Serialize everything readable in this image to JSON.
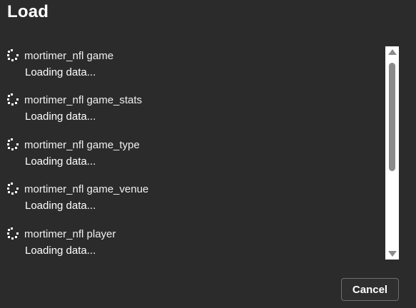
{
  "dialog": {
    "title": "Load",
    "cancel_label": "Cancel"
  },
  "items": [
    {
      "name": "mortimer_nfl game",
      "status": "Loading data...",
      "icon": "loading-spinner-icon"
    },
    {
      "name": "mortimer_nfl game_stats",
      "status": "Loading data...",
      "icon": "loading-spinner-icon"
    },
    {
      "name": "mortimer_nfl game_type",
      "status": "Loading data...",
      "icon": "loading-spinner-icon"
    },
    {
      "name": "mortimer_nfl game_venue",
      "status": "Loading data...",
      "icon": "loading-spinner-icon"
    },
    {
      "name": "mortimer_nfl player",
      "status": "Loading data...",
      "icon": "loading-spinner-icon"
    }
  ],
  "colors": {
    "background": "#2b2b2b",
    "text": "#ffffff",
    "scrollbar_track": "#ffffff",
    "scrollbar_thumb": "#8a8a8a",
    "button_border": "#6e6e6e"
  }
}
